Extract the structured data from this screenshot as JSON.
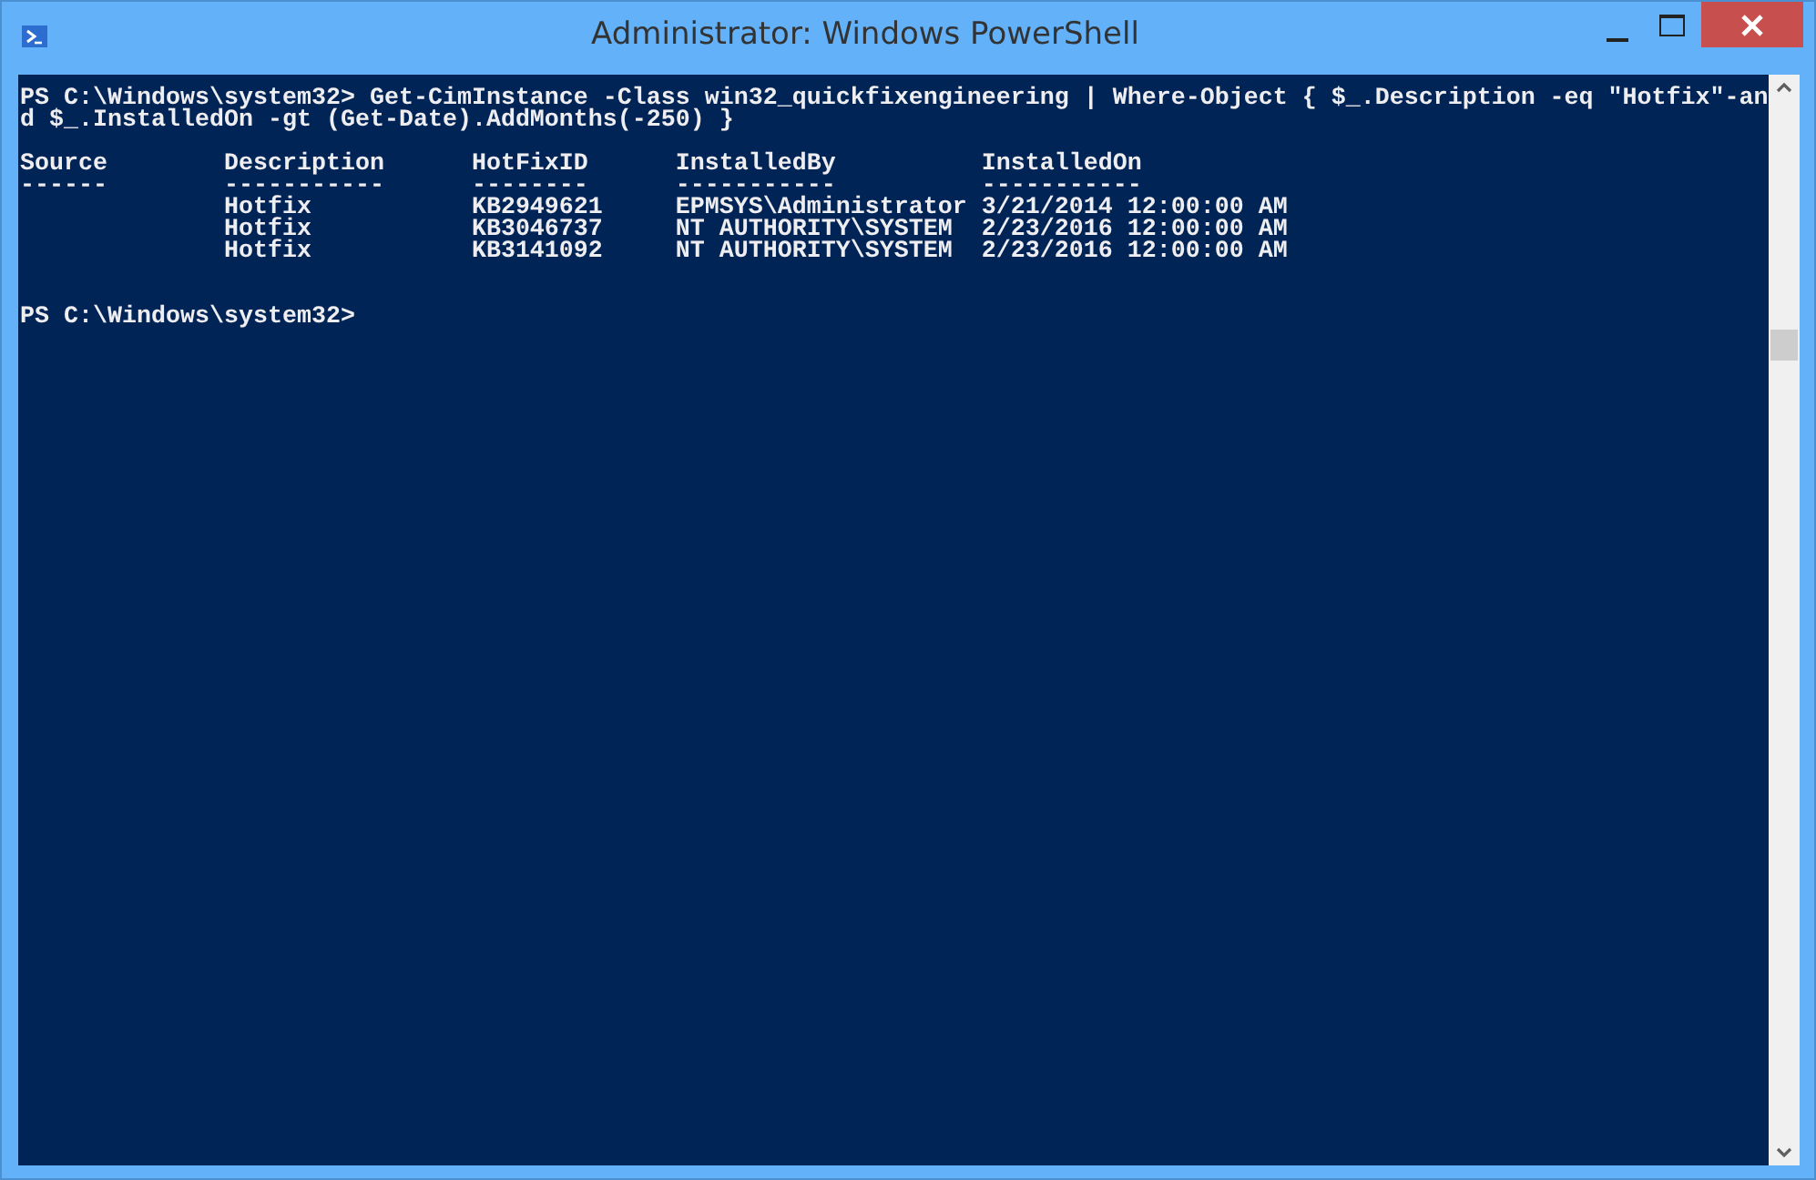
{
  "window": {
    "title": "Administrator: Windows PowerShell"
  },
  "console": {
    "groups": [
      {
        "kind": "command",
        "lines": [
          "PS C:\\Windows\\system32> Get-CimInstance -Class win32_quickfixengineering | Where-Object { $_.Description -eq \"Hotfix\"-an",
          "d $_.InstalledOn -gt (Get-Date).AddMonths(-250) }"
        ]
      },
      {
        "kind": "output",
        "lines": [
          "Source        Description      HotFixID      InstalledBy          InstalledOn",
          "------        -----------      --------      -----------          -----------",
          "              Hotfix           KB2949621     EPMSYS\\Administrator 3/21/2014 12:00:00 AM",
          "              Hotfix           KB3046737     NT AUTHORITY\\SYSTEM  2/23/2016 12:00:00 AM",
          "              Hotfix           KB3141092     NT AUTHORITY\\SYSTEM  2/23/2016 12:00:00 AM"
        ]
      },
      {
        "kind": "prompt",
        "lines": [
          "PS C:\\Windows\\system32>"
        ]
      }
    ]
  }
}
